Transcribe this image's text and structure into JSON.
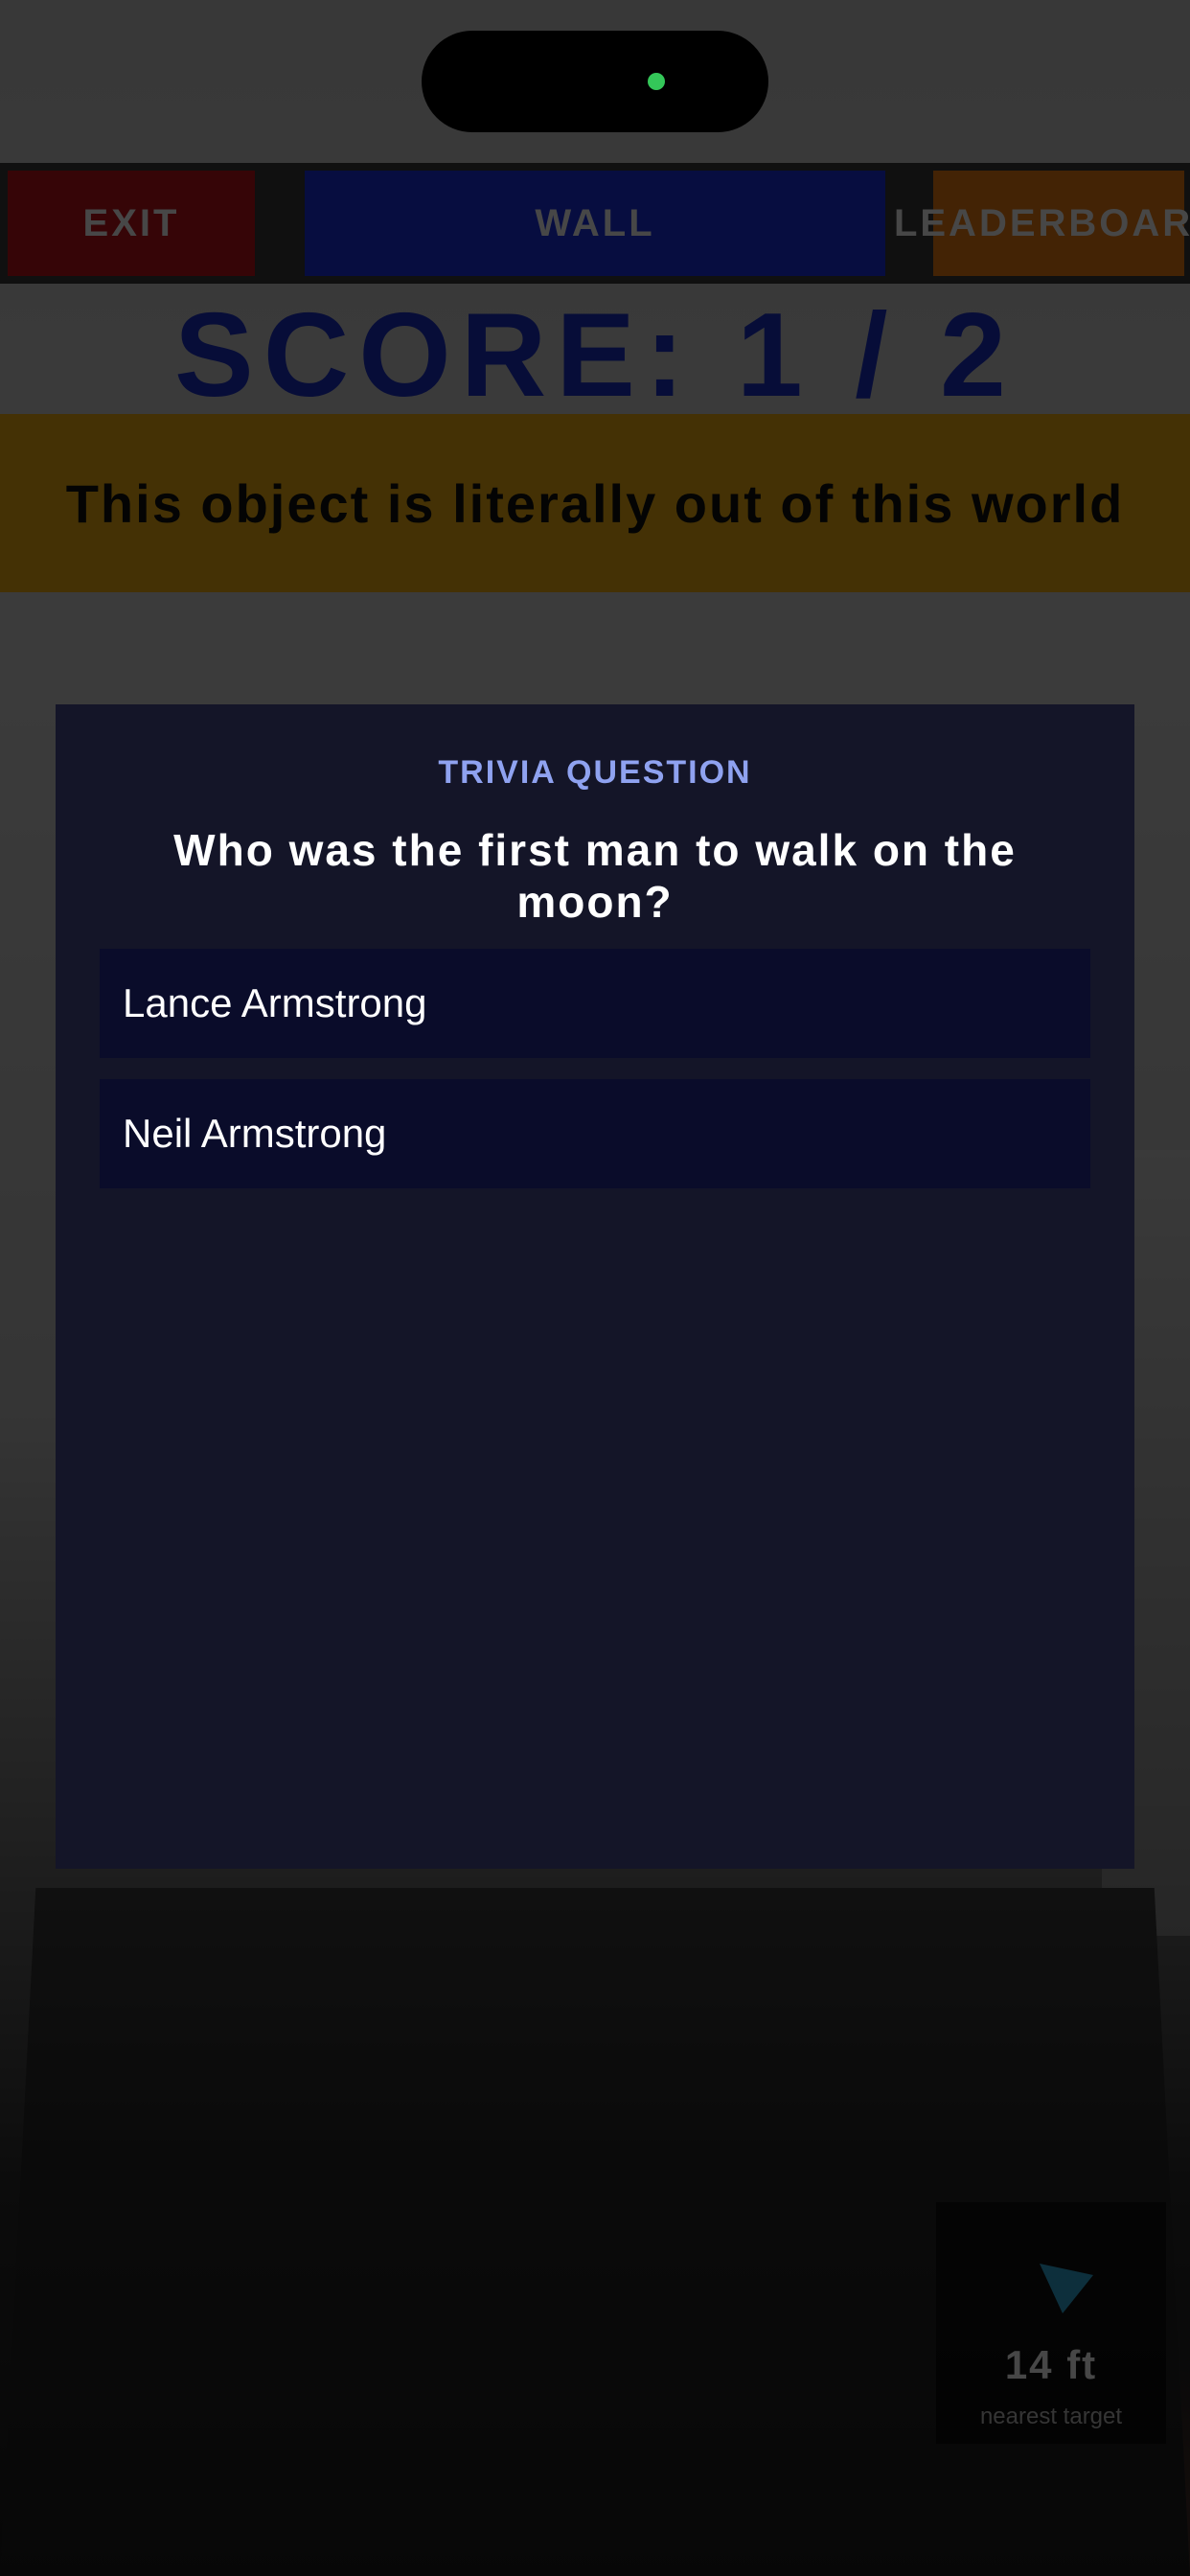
{
  "colors": {
    "exit": "#c0141a",
    "wall": "#1b30e6",
    "leaderboard": "#f07d12",
    "score": "#1b30c8",
    "hint_banner": "#f2b012",
    "modal_bg": "#141528",
    "answer_bg": "#0a0c2a",
    "modal_label": "#8fa2f0",
    "island_dot": "#34c759",
    "nav_arrow": "#2fa9d6"
  },
  "topbar": {
    "exit_label": "EXIT",
    "wall_label": "WALL",
    "leaderboard_label": "LEADERBOARD"
  },
  "score": {
    "text": "SCORE: 1 / 2"
  },
  "hint": {
    "text": "This object is literally out of this world"
  },
  "trivia": {
    "label": "TRIVIA QUESTION",
    "question": "Who was the first man to walk on the moon?",
    "answers": [
      "Lance Armstrong",
      "Neil Armstrong"
    ]
  },
  "nav": {
    "icon": "direction-arrow-icon",
    "distance": "14 ft",
    "caption": "nearest target"
  }
}
